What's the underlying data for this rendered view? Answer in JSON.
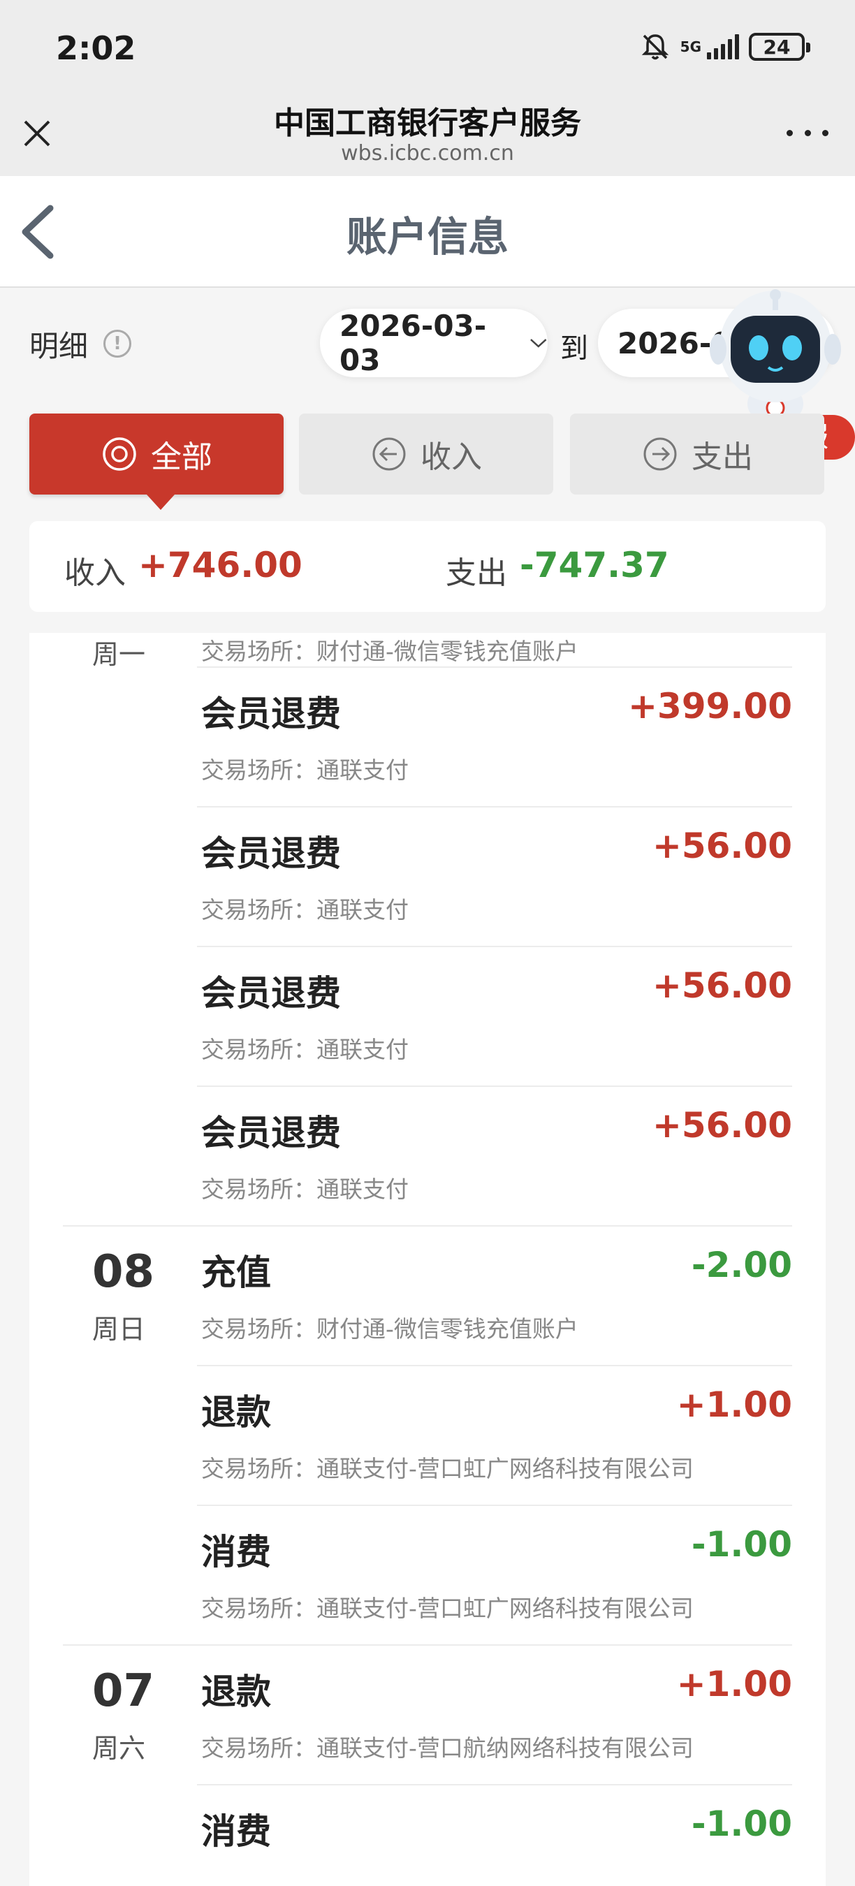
{
  "status_bar": {
    "time": "2:02",
    "network": "5G",
    "battery": "24"
  },
  "browser": {
    "title": "中国工商银行客户服务",
    "url": "wbs.icbc.com.cn"
  },
  "nav": {
    "title": "账户信息"
  },
  "filter": {
    "detail_label": "明细",
    "info_icon_glyph": "!",
    "start_date": "2026-03-03",
    "to_label": "到",
    "end_date": "2026-03-09",
    "end_date_visible": "2026-0"
  },
  "customer_service": {
    "label": "在线客服"
  },
  "tabs": [
    {
      "label": "全部",
      "icon": "target-icon",
      "active": true
    },
    {
      "label": "收入",
      "icon": "arrow-left-circle-icon",
      "active": false
    },
    {
      "label": "支出",
      "icon": "arrow-right-circle-icon",
      "active": false
    }
  ],
  "summary": {
    "income_label": "收入",
    "income_value": "+746.00",
    "expense_label": "支出",
    "expense_value": "-747.37"
  },
  "partial_row": {
    "weekday": "周一",
    "merchant": "交易场所：财付通-微信零钱充值账户"
  },
  "transactions": [
    {
      "day": "",
      "weekday": "",
      "title": "会员退费",
      "amount": "+399.00",
      "type": "income",
      "merchant": "交易场所：通联支付"
    },
    {
      "day": "",
      "weekday": "",
      "title": "会员退费",
      "amount": "+56.00",
      "type": "income",
      "merchant": "交易场所：通联支付"
    },
    {
      "day": "",
      "weekday": "",
      "title": "会员退费",
      "amount": "+56.00",
      "type": "income",
      "merchant": "交易场所：通联支付"
    },
    {
      "day": "",
      "weekday": "",
      "title": "会员退费",
      "amount": "+56.00",
      "type": "income",
      "merchant": "交易场所：通联支付"
    },
    {
      "day": "08",
      "weekday": "周日",
      "title": "充值",
      "amount": "-2.00",
      "type": "expense",
      "merchant": "交易场所：财付通-微信零钱充值账户"
    },
    {
      "day": "",
      "weekday": "",
      "title": "退款",
      "amount": "+1.00",
      "type": "income",
      "merchant": "交易场所：通联支付-营口虹广网络科技有限公司"
    },
    {
      "day": "",
      "weekday": "",
      "title": "消费",
      "amount": "-1.00",
      "type": "expense",
      "merchant": "交易场所：通联支付-营口虹广网络科技有限公司"
    },
    {
      "day": "07",
      "weekday": "周六",
      "title": "退款",
      "amount": "+1.00",
      "type": "income",
      "merchant": "交易场所：通联支付-营口航纳网络科技有限公司"
    },
    {
      "day": "",
      "weekday": "",
      "title": "消费",
      "amount": "-1.00",
      "type": "expense",
      "merchant": ""
    }
  ],
  "colors": {
    "accent": "#c8382b",
    "income": "#c0392b",
    "expense": "#3b9a3f",
    "nav_title": "#5a6470"
  }
}
